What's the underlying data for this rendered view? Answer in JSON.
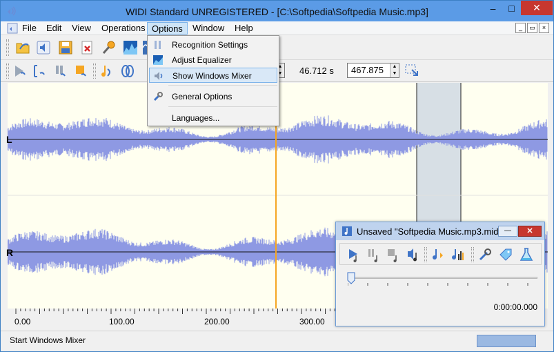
{
  "window": {
    "title": "WIDI Standard UNREGISTERED - [C:\\Softpedia\\Softpedia Music.mp3]",
    "controls": {
      "minimize": "–",
      "maximize": "□",
      "close": "✕"
    }
  },
  "menubar": {
    "items": [
      {
        "label": "File"
      },
      {
        "label": "Edit"
      },
      {
        "label": "View"
      },
      {
        "label": "Operations"
      },
      {
        "label": "Options"
      },
      {
        "label": "Window"
      },
      {
        "label": "Help"
      }
    ],
    "mdi": {
      "minimize": "_",
      "restore": "▭",
      "close": "×"
    }
  },
  "options_menu": {
    "items": [
      {
        "label": "Recognition Settings",
        "icon": "recognition-icon"
      },
      {
        "label": "Adjust Equalizer",
        "icon": "equalizer-icon"
      },
      {
        "label": "Show Windows Mixer",
        "icon": "speaker-icon"
      },
      {
        "label": "General Options",
        "icon": "tools-icon"
      },
      {
        "label": "Languages...",
        "icon": ""
      }
    ]
  },
  "toolbar2": {
    "position_value": "46.712 s",
    "end_value": "467.875"
  },
  "waveform": {
    "left_label": "L",
    "right_label": "R",
    "wave_color": "#8e99e3",
    "cursor_color": "#f5a623",
    "selection_color": "#d3dbe3",
    "background": "#fffff0"
  },
  "timeline": {
    "labels": [
      "0.00",
      "100.00",
      "200.00",
      "300.00"
    ]
  },
  "status": {
    "text": "Start Windows Mixer"
  },
  "midi_window": {
    "title": "Unsaved \"Softpedia Music.mp3.mid...",
    "minimize": "—",
    "close": "✕",
    "time": "0:00:00.000"
  }
}
